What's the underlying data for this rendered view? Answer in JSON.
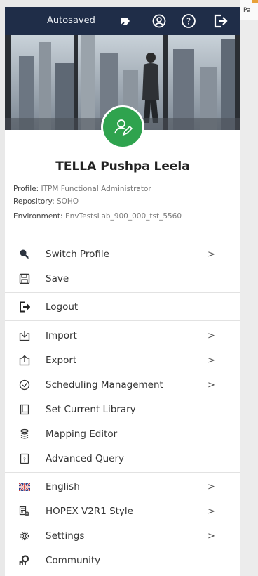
{
  "topbar": {
    "autosaved_label": "Autosaved",
    "icons": [
      "pin-icon",
      "user-circle-icon",
      "help-icon",
      "logout-icon"
    ]
  },
  "backdrop": {
    "text": "Pa"
  },
  "profile": {
    "name": "TELLA Pushpa Leela",
    "profile_key": "Profile:",
    "profile_value": "ITPM Functional Administrator",
    "repository_key": "Repository:",
    "repository_value": "SOHO",
    "environment_key": "Environment:",
    "environment_value": "EnvTestsLab_900_000_tst_5560"
  },
  "menu": {
    "switch_profile": "Switch Profile",
    "save": "Save",
    "logout": "Logout",
    "import": "Import",
    "export": "Export",
    "scheduling": "Scheduling Management",
    "set_library": "Set Current Library",
    "mapping_editor": "Mapping Editor",
    "advanced_query": "Advanced Query",
    "english": "English",
    "style": "HOPEX V2R1 Style",
    "settings": "Settings",
    "community": "Community",
    "chevron": ">"
  },
  "colors": {
    "topbar": "#1f2d48",
    "avatar": "#2fa34e",
    "text": "#333333"
  }
}
